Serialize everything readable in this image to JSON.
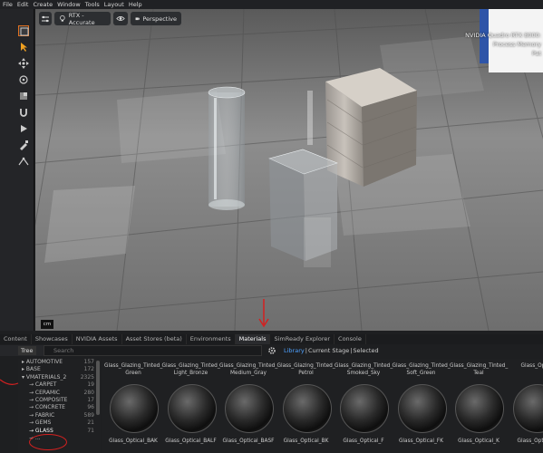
{
  "menu": [
    "File",
    "Edit",
    "Create",
    "Window",
    "Tools",
    "Layout",
    "Help"
  ],
  "viewport": {
    "render_mode": "RTX - Accurate",
    "camera": "Perspective",
    "hud_lines": [
      "NVIDIA Quadro RTX 8000:",
      "Process Memory",
      "Pat"
    ],
    "unit_label": "cm"
  },
  "tabs": [
    {
      "label": "Content",
      "active": false
    },
    {
      "label": "Showcases",
      "active": false
    },
    {
      "label": "NVIDIA Assets",
      "active": false
    },
    {
      "label": "Asset Stores (beta)",
      "active": false
    },
    {
      "label": "Environments",
      "active": false
    },
    {
      "label": "Materials",
      "active": true
    },
    {
      "label": "SimReady Explorer",
      "active": false
    },
    {
      "label": "Console",
      "active": false
    }
  ],
  "tree_button": "Tree",
  "search": {
    "placeholder": "Search"
  },
  "library_bar": {
    "library": "Library",
    "sep1": "|",
    "current_stage": "Current Stage",
    "sep2": "|",
    "selected": "Selected"
  },
  "tree": [
    {
      "label": "▸ AUTOMOTIVE",
      "count": "157",
      "indent": 0
    },
    {
      "label": "▸ BASE",
      "count": "172",
      "indent": 0
    },
    {
      "label": "▾ VMATERIALS_2",
      "count": "2325",
      "indent": 0
    },
    {
      "label": "→ CARPET",
      "count": "19",
      "indent": 1
    },
    {
      "label": "→ CERAMIC",
      "count": "280",
      "indent": 1
    },
    {
      "label": "→ COMPOSITE",
      "count": "17",
      "indent": 1
    },
    {
      "label": "→ CONCRETE",
      "count": "96",
      "indent": 1
    },
    {
      "label": "→ FABRIC",
      "count": "589",
      "indent": 1
    },
    {
      "label": "→ GEMS",
      "count": "21",
      "indent": 1
    },
    {
      "label": "→ GLASS",
      "count": "71",
      "indent": 1,
      "selected": true
    },
    {
      "label": "→ ...",
      "count": "",
      "indent": 1
    }
  ],
  "materials": [
    {
      "title": "Glass_Glazing_Tinted_ Green",
      "name": "Glass_Optical_BAK"
    },
    {
      "title": "Glass_Glazing_Tinted_ Light_Bronze",
      "name": "Glass_Optical_BALF"
    },
    {
      "title": "Glass_Glazing_Tinted_ Medium_Gray",
      "name": "Glass_Optical_BASF"
    },
    {
      "title": "Glass_Glazing_Tinted_ Petrol",
      "name": "Glass_Optical_BK"
    },
    {
      "title": "Glass_Glazing_Tinted_ Smoked_Sky",
      "name": "Glass_Optical_F"
    },
    {
      "title": "Glass_Glazing_Tinted_ Soft_Green",
      "name": "Glass_Optical_FK"
    },
    {
      "title": "Glass_Glazing_Tinted_ Teal",
      "name": "Glass_Optical_K"
    },
    {
      "title": "Glass_Optic",
      "name": "Glass_Optical_"
    }
  ],
  "colors": {
    "accent": "#4ea1ff",
    "annotation": "#d42020"
  }
}
